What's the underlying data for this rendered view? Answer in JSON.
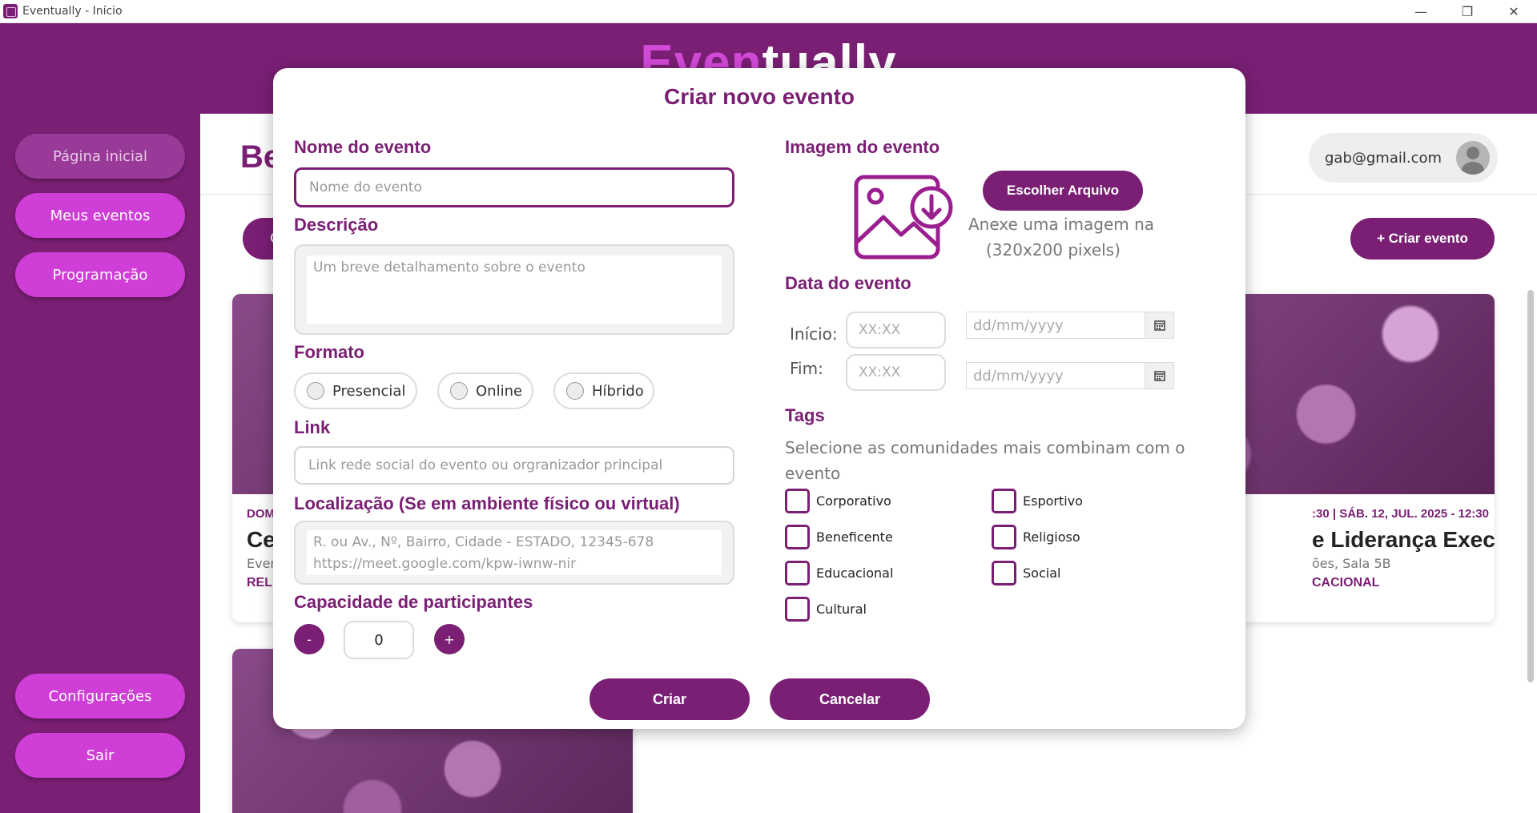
{
  "window": {
    "title": "Eventually - Início",
    "minimize": "—",
    "maximize": "❐",
    "close": "✕"
  },
  "header": {
    "logo_part1": "Even",
    "logo_part2": "tually"
  },
  "sidebar": {
    "items": [
      {
        "label": "Página inicial"
      },
      {
        "label": "Meus eventos"
      },
      {
        "label": "Programação"
      },
      {
        "label": "Configurações"
      },
      {
        "label": "Sair"
      }
    ]
  },
  "main": {
    "title_partial": "Be",
    "user_email": "gab@gmail.com",
    "filter_partial": "C",
    "create_event": "+ Criar evento",
    "cards": [
      {
        "meta": "DOM",
        "title": "Ce",
        "location": "Even",
        "tag": "RELI"
      },
      {
        "meta": ":30 | SÁB. 12, JUL. 2025 - 12:30",
        "title": "e Liderança Execut...",
        "location": "ões, Sala 5B",
        "tag": "CACIONAL"
      }
    ]
  },
  "modal": {
    "title": "Criar novo evento",
    "name": {
      "label": "Nome do evento",
      "placeholder": "Nome do evento"
    },
    "description": {
      "label": "Descrição",
      "placeholder": "Um breve detalhamento sobre o evento"
    },
    "format": {
      "label": "Formato",
      "options": [
        "Presencial",
        "Online",
        "Híbrido"
      ]
    },
    "link": {
      "label": "Link",
      "placeholder": "Link rede social do evento ou orgranizador principal"
    },
    "location": {
      "label": "Localização (Se em ambiente físico ou virtual)",
      "placeholder_line1": "R. ou Av., Nº, Bairro, Cidade - ESTADO, 12345-678",
      "placeholder_line2": "https://meet.google.com/kpw-iwnw-nir"
    },
    "capacity": {
      "label": "Capacidade de participantes",
      "minus": "-",
      "value": "0",
      "plus": "+"
    },
    "image": {
      "label": "Imagem do evento",
      "button": "Escolher Arquivo",
      "hint_line1": "Anexe uma imagem na",
      "hint_line2": "(320x200 pixels)"
    },
    "date": {
      "label": "Data do evento",
      "start_label": "Início:",
      "end_label": "Fim:",
      "time_placeholder": "XX:XX",
      "date_placeholder": "dd/mm/yyyy"
    },
    "tags": {
      "label": "Tags",
      "hint": "Selecione as comunidades mais combinam com o evento",
      "options": [
        "Corporativo",
        "Esportivo",
        "Beneficente",
        "Religioso",
        "Educacional",
        "Social",
        "Cultural"
      ]
    },
    "actions": {
      "create": "Criar",
      "cancel": "Cancelar"
    }
  },
  "colors": {
    "primary": "#7a1f74",
    "accent": "#cf3ed6",
    "sidebar_active": "#9a3a98"
  }
}
